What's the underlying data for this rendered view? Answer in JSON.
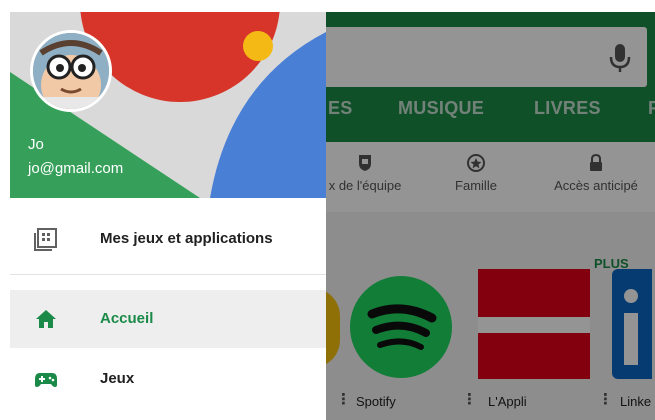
{
  "app": {
    "tabs": [
      {
        "label": "ES"
      },
      {
        "label": "MUSIQUE"
      },
      {
        "label": "LIVRES"
      },
      {
        "label": "F"
      }
    ],
    "chips": [
      {
        "label": "x de l'équipe",
        "icon": "shield-icon"
      },
      {
        "label": "Famille",
        "icon": "star-badge-icon"
      },
      {
        "label": "Accès anticipé",
        "icon": "lock-icon"
      }
    ],
    "section_more_label": "PLUS",
    "apps": [
      {
        "label": "Spotify"
      },
      {
        "label": "L'Appli"
      },
      {
        "label": "Linke"
      }
    ],
    "colors": {
      "brand_green": "#1b8a48",
      "spotify_green": "#1ed760",
      "appli_red": "#e2001a",
      "linkedin_blue": "#0a66c2"
    }
  },
  "drawer": {
    "user": {
      "name": "Jo",
      "email": "jo@gmail.com"
    },
    "items": [
      {
        "label": "Mes jeux et applications",
        "icon": "apps-grid-icon",
        "active": false
      },
      {
        "label": "Accueil",
        "icon": "home-icon",
        "active": true
      },
      {
        "label": "Jeux",
        "icon": "gamepad-icon",
        "active": false
      }
    ],
    "colors": {
      "active": "#1b8a48",
      "header_red": "#d8352a",
      "header_blue": "#4a7fd6",
      "header_green": "#36a05a",
      "header_yellow": "#f4b915"
    }
  }
}
